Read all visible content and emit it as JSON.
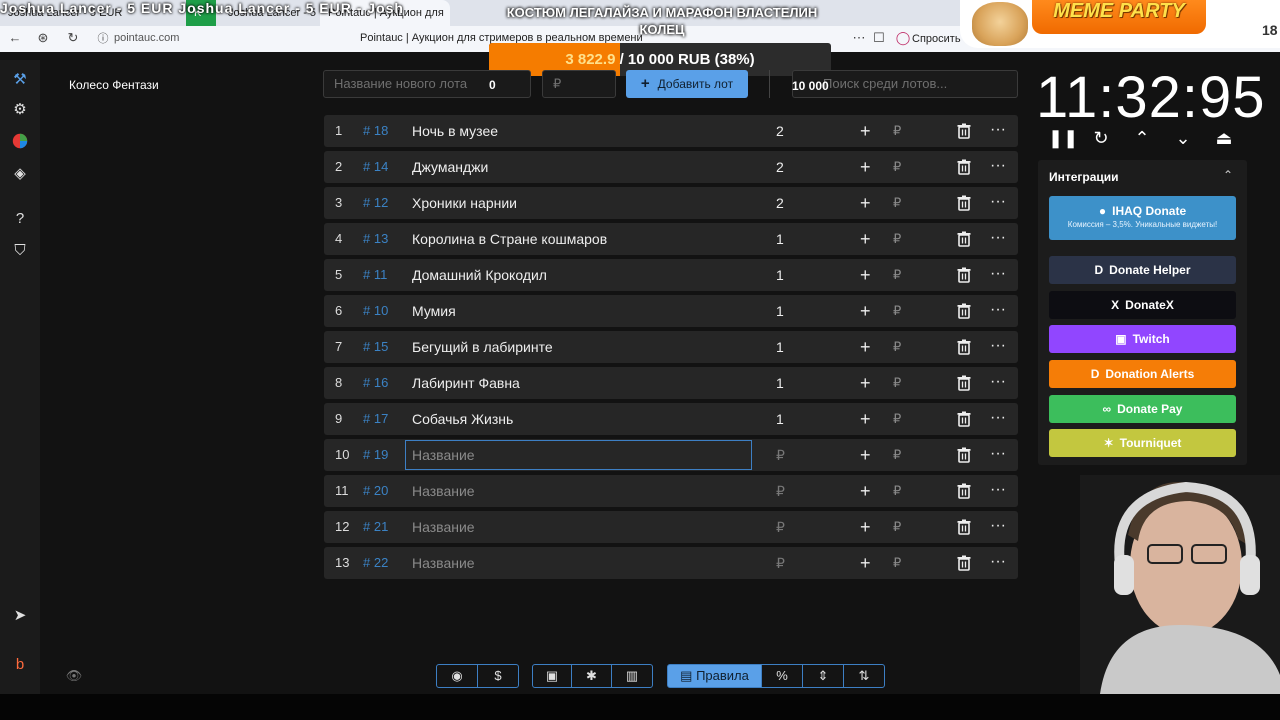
{
  "browser": {
    "tabs": [
      {
        "label": "Joshua Lancer - 5 EUR"
      },
      {
        "label": "Ri..."
      },
      {
        "label": "Joshua Lancer - 5 EUR"
      },
      {
        "label": "Pointauc | Аукцион для"
      }
    ],
    "overlay_text": "Joshua Lancer - 5 EUR   Joshua Lancer - 5 EUR - Josh",
    "url": "pointauc.com",
    "page_title": "Pointauc | Аукцион для стримеров в реальном времени",
    "menu_fragment": "Спросить"
  },
  "stream_overlay": {
    "title": "КОСТЮМ ЛЕГАЛАЙЗА И МАРАФОН ВЛАСТЕЛИН КОЛЕЦ",
    "meme_label": "MEME PARTY",
    "meme_number": "18"
  },
  "progress": {
    "current": "3 822.9",
    "rest": "/ 10 000 RUB (38%)",
    "fraction": 0.382
  },
  "wheel_name": "Колесо Фентази",
  "new_lot": {
    "name_placeholder": "Название нового лота",
    "name_value": "0",
    "amount_placeholder": "₽",
    "add_label": "Добавить лот",
    "search_placeholder": "Поиск среди лотов...",
    "search_value": "10 000"
  },
  "lots": [
    {
      "idx": "1",
      "id": "# 18",
      "name": "Ночь в музее",
      "amount": "2"
    },
    {
      "idx": "2",
      "id": "# 14",
      "name": "Джуманджи",
      "amount": "2"
    },
    {
      "idx": "3",
      "id": "# 12",
      "name": "Хроники нарнии",
      "amount": "2"
    },
    {
      "idx": "4",
      "id": "# 13",
      "name": "Королина в Стране кошмаров",
      "amount": "1"
    },
    {
      "idx": "5",
      "id": "# 11",
      "name": "Домашний Крокодил",
      "amount": "1"
    },
    {
      "idx": "6",
      "id": "# 10",
      "name": "Мумия",
      "amount": "1"
    },
    {
      "idx": "7",
      "id": "# 15",
      "name": "Бегущий в лабиринте",
      "amount": "1"
    },
    {
      "idx": "8",
      "id": "# 16",
      "name": "Лабиринт Фавна",
      "amount": "1"
    },
    {
      "idx": "9",
      "id": "# 17",
      "name": "Собачья Жизнь",
      "amount": "1"
    },
    {
      "idx": "10",
      "id": "# 19",
      "name": "Название",
      "amount": "₽"
    },
    {
      "idx": "11",
      "id": "# 20",
      "name": "Название",
      "amount": "₽"
    },
    {
      "idx": "12",
      "id": "# 21",
      "name": "Название",
      "amount": "₽"
    },
    {
      "idx": "13",
      "id": "# 22",
      "name": "Название",
      "amount": "₽"
    }
  ],
  "row_symbols": {
    "plus": "+",
    "rub": "₽",
    "more": "···"
  },
  "toolbar": {
    "rules_label": "Правила",
    "percent_label": "%"
  },
  "timer": {
    "value": "11:32:95"
  },
  "integrations": {
    "title": "Интеграции",
    "items": [
      {
        "label": "IHAQ Donate",
        "sub": "Комиссия – 3,5%. Уникальные виджеты!",
        "color": "#3d91c9"
      },
      {
        "label": "Donate Helper",
        "color": "#2b3347"
      },
      {
        "label": "DonateX",
        "color": "#0d0d12"
      },
      {
        "label": "Twitch",
        "color": "#9146ff"
      },
      {
        "label": "Donation Alerts",
        "color": "#f57d07"
      },
      {
        "label": "Donate Pay",
        "color": "#3cbe5c"
      },
      {
        "label": "Tourniquet",
        "color": "#c3c73f"
      }
    ]
  },
  "colors": {
    "accent": "#5aa0e8",
    "progress_fill": "#f57c00",
    "lot_id": "#3b82c4"
  }
}
